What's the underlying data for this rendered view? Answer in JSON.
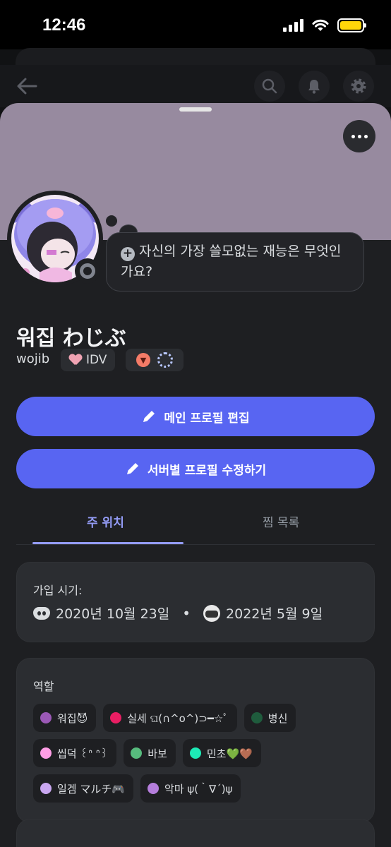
{
  "status_bar": {
    "time": "12:46"
  },
  "profile": {
    "custom_status": "자신의 가장 쓸모없는 재능은 무엇인가요?",
    "display_name": "워집 わじぶ",
    "username": "wojib",
    "tag": "IDV"
  },
  "actions": {
    "edit_main_profile": "메인 프로필 편집",
    "edit_server_profile": "서버별 프로필 수정하기"
  },
  "tabs": [
    {
      "label": "주 위치",
      "active": true
    },
    {
      "label": "찜 목록",
      "active": false
    }
  ],
  "joined": {
    "title": "가입 시기:",
    "discord_date": "2020년 10월 23일",
    "server_date": "2022년 5월 9일"
  },
  "roles": {
    "title": "역할",
    "items": [
      {
        "name": "워집😈",
        "color": "#9b59b6"
      },
      {
        "name": "실세 ଘ(∩^o^)⊃━☆ﾟ",
        "color": "#e91e63"
      },
      {
        "name": "병신",
        "color": "#1f5c3d"
      },
      {
        "name": "씹덕 ꒰ᐢ ᐢ꒱",
        "color": "#ff9ee6"
      },
      {
        "name": "바보",
        "color": "#57bb7d"
      },
      {
        "name": "민초💚🤎",
        "color": "#1de9b6"
      },
      {
        "name": "일겜 マルチ🎮",
        "color": "#c9a7f0"
      },
      {
        "name": "악마 ψ(｀∇´)ψ",
        "color": "#b57edc"
      }
    ]
  },
  "colors": {
    "accent": "#5865f2",
    "banner": "#978a9f",
    "tab_active": "#949cf7",
    "background": "#1e1f22",
    "card": "#2b2d31"
  },
  "icons": [
    "back-arrow-icon",
    "search-icon",
    "bell-icon",
    "gear-icon",
    "more-icon",
    "plus-icon",
    "pencil-icon",
    "discord-logo-icon"
  ]
}
